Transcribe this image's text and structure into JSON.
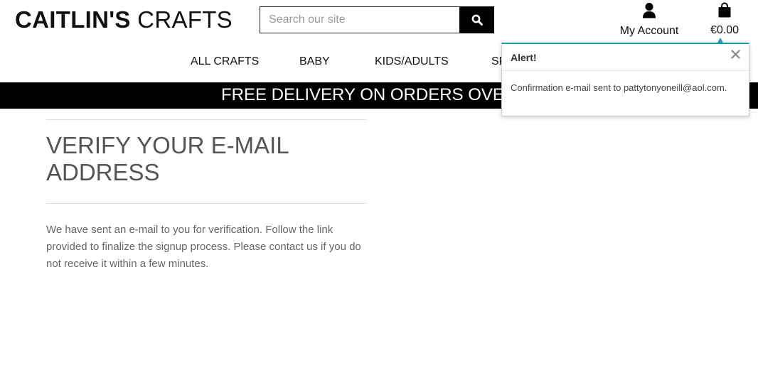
{
  "brand": {
    "bold": "CAITLIN'S",
    "light": " CRAFTS"
  },
  "search": {
    "placeholder": "Search our site",
    "icon": "search-icon"
  },
  "account": {
    "label": "My Account",
    "icon": "user-icon"
  },
  "cart": {
    "total": "€0.00",
    "icon": "shopping-bag-icon"
  },
  "nav": {
    "items": [
      "ALL CRAFTS",
      "BABY",
      "KIDS/ADULTS",
      "SPECIALS"
    ]
  },
  "banner": {
    "text": "FREE DELIVERY ON ORDERS OVER €"
  },
  "main": {
    "title": "VERIFY YOUR E-MAIL ADDRESS",
    "message": "We have sent an e-mail to you for verification. Follow the link provided to finalize the signup process. Please contact us if you do not receive it within a few minutes."
  },
  "alert": {
    "title": "Alert!",
    "message": "Confirmation e-mail sent to pattytonyoneill@aol.com.",
    "accent_color": "#17a2b8"
  }
}
